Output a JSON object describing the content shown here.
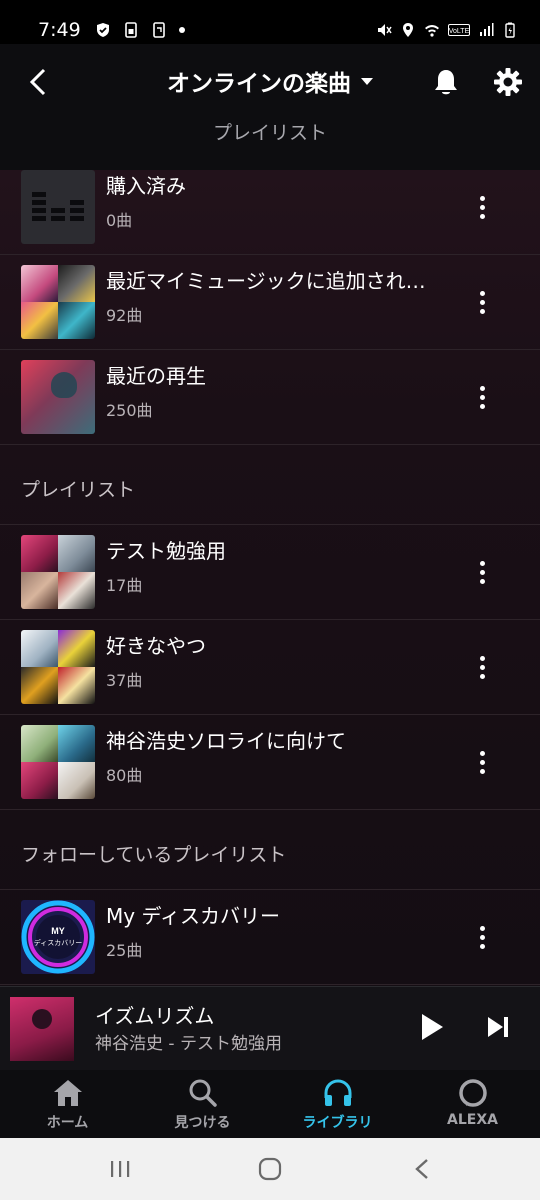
{
  "status_bar": {
    "time": "7:49",
    "icons": [
      "shield-check-icon",
      "sim-icon",
      "screenshot-icon",
      "mute-icon",
      "location-icon",
      "wifi-icon",
      "volte-icon",
      "signal-icon",
      "battery-icon"
    ]
  },
  "header": {
    "title": "オンラインの楽曲",
    "subtitle": "プレイリスト"
  },
  "smart_lists": [
    {
      "name": "購入済み",
      "count": "0曲",
      "thumb": "purchased"
    },
    {
      "name": "最近マイミュージックに追加され…",
      "count": "92曲",
      "thumb": "grid"
    },
    {
      "name": "最近の再生",
      "count": "250曲",
      "thumb": "recent"
    }
  ],
  "sections": {
    "playlists": "プレイリスト",
    "followed": "フォローしているプレイリスト"
  },
  "playlists": [
    {
      "name": "テスト勉強用",
      "count": "17曲"
    },
    {
      "name": "好きなやつ",
      "count": "37曲"
    },
    {
      "name": "神谷浩史ソロライに向けて",
      "count": "80曲"
    }
  ],
  "followed": [
    {
      "name": "My ディスカバリー",
      "count": "25曲",
      "thumb_text_1": "MY",
      "thumb_text_2": "ディスカバリー"
    }
  ],
  "player": {
    "title": "イズムリズム",
    "subtitle": "神谷浩史 - テスト勉強用"
  },
  "nav": {
    "home": "ホーム",
    "find": "見つける",
    "library": "ライブラリ",
    "alexa": "ALEXA",
    "active": "library"
  },
  "colors": {
    "accent": "#35c3ea",
    "background": "#0f0b10"
  }
}
